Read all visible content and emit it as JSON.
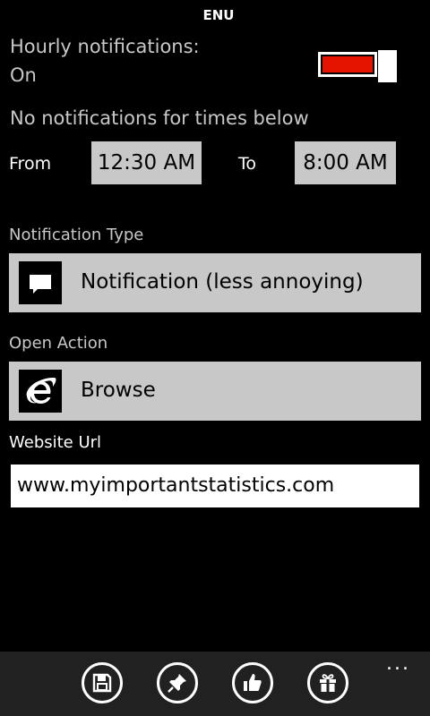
{
  "status": {
    "lang": "ENU"
  },
  "hourly": {
    "label": "Hourly notifications:",
    "value": "On",
    "toggle_on": true,
    "accent": "#e51400"
  },
  "quiet": {
    "heading": "No notifications for times below",
    "from_label": "From",
    "from_value": "12:30 AM",
    "to_label": "To",
    "to_value": "8:00 AM"
  },
  "notification_type": {
    "label": "Notification Type",
    "value": "Notification (less annoying)",
    "icon": "message-icon"
  },
  "open_action": {
    "label": "Open Action",
    "value": "Browse",
    "icon": "internet-explorer-icon"
  },
  "website": {
    "label": "Website Url",
    "value": "www.myimportantstatistics.com"
  },
  "appbar": {
    "buttons": [
      {
        "icon": "save-icon"
      },
      {
        "icon": "pin-icon"
      },
      {
        "icon": "thumbs-up-icon"
      },
      {
        "icon": "gift-icon"
      }
    ],
    "more": "..."
  }
}
